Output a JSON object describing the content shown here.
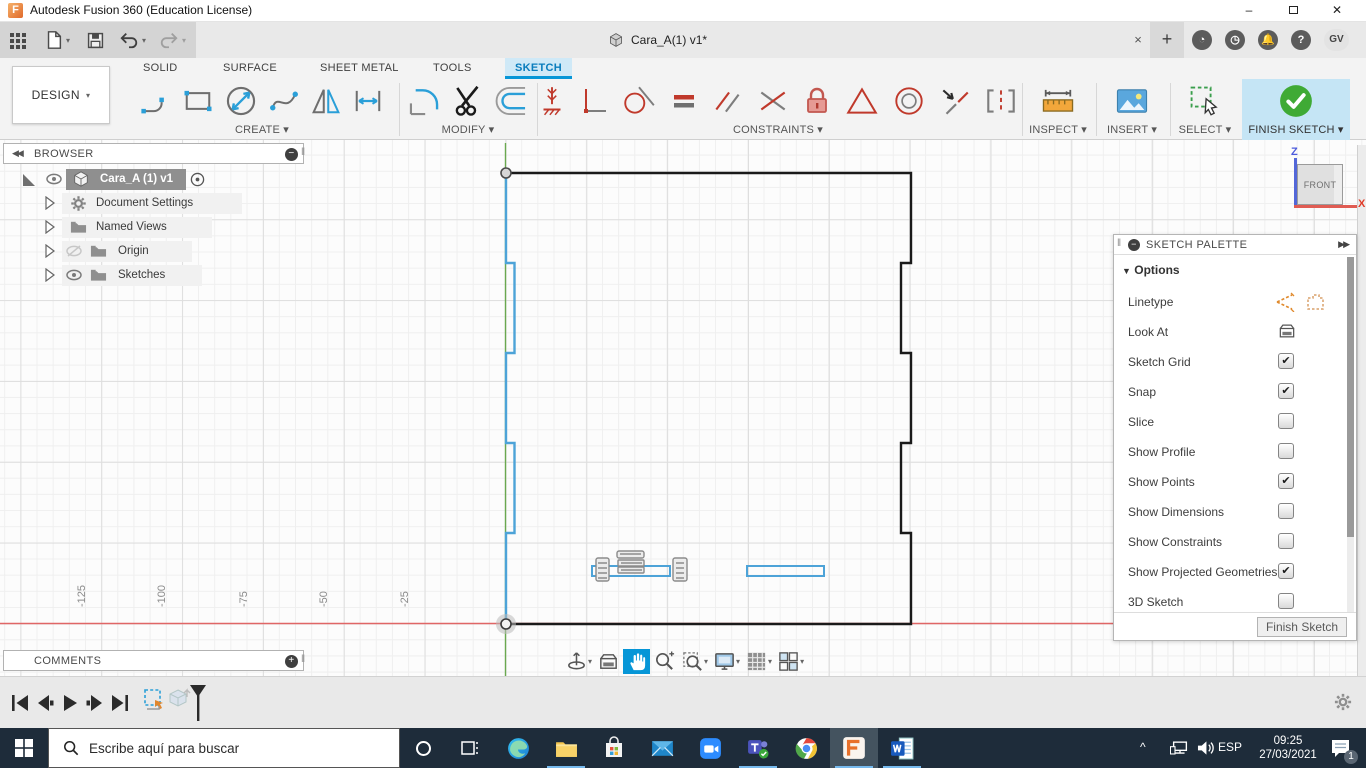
{
  "window": {
    "title": "Autodesk Fusion 360 (Education License)"
  },
  "quick_access": {
    "icons": [
      "app-grid-icon",
      "file-icon",
      "save-icon",
      "undo-icon",
      "redo-icon"
    ]
  },
  "document_tabs": {
    "active": {
      "icon": "cube-icon",
      "label": "Cara_A(1) v1*"
    },
    "close_label": "×",
    "new_tab_label": "+",
    "right_icons": [
      "extensions-icon",
      "clock-icon",
      "bell-icon",
      "help-icon"
    ],
    "avatar": "GV"
  },
  "workspace_selector": {
    "label": "DESIGN",
    "caret": "▾"
  },
  "ribbon": {
    "tabs": [
      {
        "label": "SOLID",
        "active": false
      },
      {
        "label": "SURFACE",
        "active": false
      },
      {
        "label": "SHEET METAL",
        "active": false
      },
      {
        "label": "TOOLS",
        "active": false
      },
      {
        "label": "SKETCH",
        "active": true
      }
    ],
    "groups": [
      {
        "label": "CREATE ▾"
      },
      {
        "label": "MODIFY ▾"
      },
      {
        "label": "CONSTRAINTS ▾"
      },
      {
        "label": "INSPECT ▾"
      },
      {
        "label": "INSERT ▾"
      },
      {
        "label": "SELECT ▾"
      },
      {
        "label": "FINISH SKETCH ▾"
      }
    ]
  },
  "browser": {
    "title": "BROWSER",
    "root": {
      "label": "Cara_A (1) v1"
    },
    "items": [
      {
        "label": "Document Settings",
        "icon": "gear-icon"
      },
      {
        "label": "Named Views",
        "icon": "folder-icon"
      },
      {
        "label": "Origin",
        "icon": "folder-icon",
        "visibility": "hidden"
      },
      {
        "label": "Sketches",
        "icon": "folder-icon",
        "visibility": "visible"
      }
    ]
  },
  "sketch_palette": {
    "title": "SKETCH PALETTE",
    "section_label": "Options",
    "options": [
      {
        "label": "Linetype",
        "control": "icons"
      },
      {
        "label": "Look At",
        "control": "icon"
      },
      {
        "label": "Sketch Grid",
        "control": "checkbox",
        "checked": true
      },
      {
        "label": "Snap",
        "control": "checkbox",
        "checked": true
      },
      {
        "label": "Slice",
        "control": "checkbox",
        "checked": false
      },
      {
        "label": "Show Profile",
        "control": "checkbox",
        "checked": false
      },
      {
        "label": "Show Points",
        "control": "checkbox",
        "checked": true
      },
      {
        "label": "Show Dimensions",
        "control": "checkbox",
        "checked": false
      },
      {
        "label": "Show Constraints",
        "control": "checkbox",
        "checked": false
      },
      {
        "label": "Show Projected Geometries",
        "control": "checkbox",
        "checked": true
      },
      {
        "label": "3D Sketch",
        "control": "checkbox",
        "checked": false
      }
    ],
    "finish_button": "Finish Sketch"
  },
  "viewcube": {
    "face_label": "FRONT",
    "z_label": "Z",
    "x_label": "X"
  },
  "canvas": {
    "axis_tick_labels": [
      "-125",
      "-100",
      "-75",
      "-50",
      "-25"
    ],
    "accent_colors": {
      "sketch_line_blue": "#4da3d8",
      "profile_black": "#1a1a1a",
      "x_axis_red": "#e06666",
      "y_axis_green": "#6aa84f"
    }
  },
  "comments": {
    "title": "COMMENTS"
  },
  "view_toolbar": {
    "icons": [
      "orbit-icon",
      "look-at-icon",
      "pan-icon",
      "zoom-icon",
      "fit-icon",
      "display-settings-icon",
      "grid-settings-icon",
      "viewports-icon"
    ],
    "active_icon": "pan-icon"
  },
  "timeline": {
    "playback_icons": [
      "skip-start-icon",
      "step-back-icon",
      "play-icon",
      "step-forward-icon",
      "skip-end-icon"
    ],
    "feature_icons": [
      "sketch-feature-icon",
      "component-feature-icon"
    ]
  },
  "taskbar": {
    "search_placeholder": "Escribe aquí para buscar",
    "apps": [
      "task-view",
      "edge",
      "file-explorer",
      "store",
      "mail",
      "zoom",
      "teams",
      "chrome",
      "fusion-360",
      "word"
    ],
    "open_apps": [
      "file-explorer",
      "teams",
      "fusion-360",
      "word"
    ],
    "tray": {
      "hidden_icons_chevron": "^",
      "language": "ESP",
      "time": "09:25",
      "date": "27/03/2021",
      "notification_count": "1"
    }
  }
}
